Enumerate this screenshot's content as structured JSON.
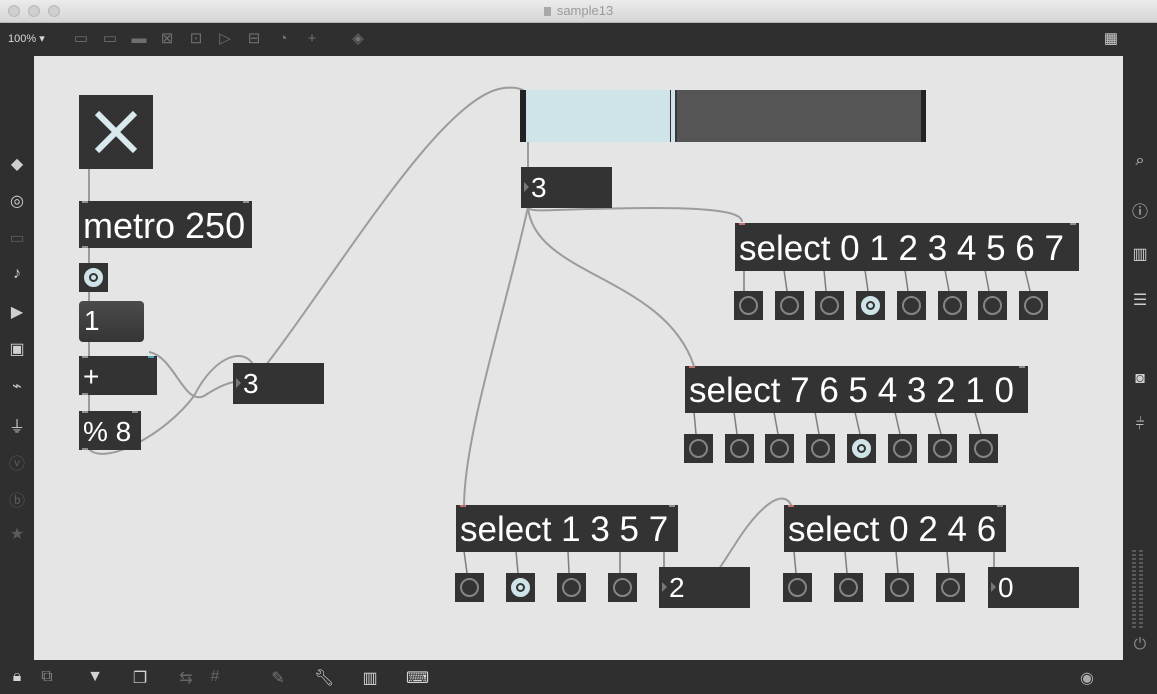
{
  "window": {
    "title": "sample13"
  },
  "toolbar": {
    "zoom": "100%"
  },
  "patch": {
    "toggle": {
      "state": "on"
    },
    "metro": {
      "text": "metro 250"
    },
    "message_box": {
      "text": "1"
    },
    "plus": {
      "text": "+"
    },
    "mod": {
      "text": "% 8"
    },
    "counter_number": {
      "value": "3"
    },
    "slider": {
      "value": 3,
      "max": 8
    },
    "slider_number": {
      "value": "3"
    },
    "select_a": {
      "text": "select 0 1 2 3 4 5 6 7",
      "active_index": 3
    },
    "select_b": {
      "text": "select 7 6 5 4 3 2 1 0",
      "active_index": 4
    },
    "select_c": {
      "text": "select 1 3 5 7",
      "active_index": 1
    },
    "select_c_number": {
      "value": "2"
    },
    "select_d": {
      "text": "select 0 2 4 6",
      "active_index": -1
    },
    "select_d_number": {
      "value": "0"
    }
  },
  "left_sidebar_icons": [
    "objects-cube-icon",
    "target-icon",
    "bpatcher-icon",
    "music-note-icon",
    "playlist-icon",
    "image-icon",
    "attachment-icon",
    "plug-icon",
    "vizzie-icon",
    "beap-icon",
    "star-icon"
  ],
  "right_sidebar_icons": [
    "search-icon",
    "info-icon",
    "book-icon",
    "list-icon",
    "camera-icon",
    "mixer-icon",
    "power-icon"
  ],
  "colors": {
    "canvas": "#e5e5e5",
    "object": "#333333",
    "accent": "#cfe4e8",
    "chrome": "#2f2f2f"
  }
}
